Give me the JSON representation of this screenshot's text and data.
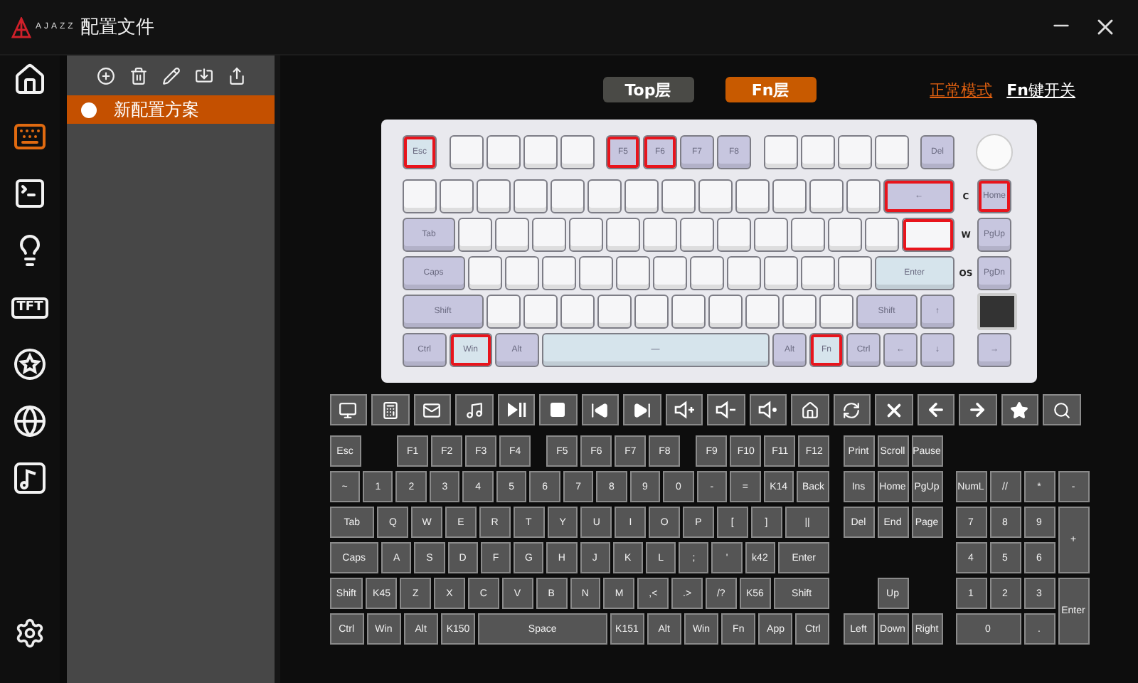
{
  "title_bar": {
    "brand": "AJAZZ",
    "title": "配置文件"
  },
  "nav": [
    {
      "selected": false
    },
    {
      "selected": true
    },
    {
      "selected": false
    },
    {
      "selected": false
    },
    {
      "label": "TFT",
      "selected": false
    },
    {
      "selected": false
    },
    {
      "selected": false
    },
    {
      "selected": false
    }
  ],
  "profiles": [
    {
      "name": "新配置方案",
      "selected": true
    }
  ],
  "layers": [
    {
      "label": "Top层",
      "selected": false
    },
    {
      "label": "Fn层",
      "selected": true
    }
  ],
  "modes": [
    {
      "label": "正常模式",
      "selected": true
    },
    {
      "label": "**Fn**键开关",
      "selected": false
    }
  ],
  "keyboard": {
    "indicators": [
      "C",
      "W",
      "OS"
    ],
    "function_row": [
      [
        {
          "kind": "blue",
          "label": "Esc",
          "selected": true
        }
      ],
      [
        {
          "kind": "white",
          "selected": false
        },
        {
          "kind": "white",
          "selected": false
        },
        {
          "kind": "white",
          "selected": false
        },
        {
          "kind": "white",
          "selected": false
        }
      ],
      [
        {
          "kind": "purple",
          "label": "F5",
          "selected": true
        },
        {
          "kind": "purple",
          "label": "F6",
          "selected": true
        },
        {
          "kind": "purple",
          "label": "F7",
          "selected": false
        },
        {
          "kind": "purple",
          "label": "F8",
          "selected": false
        }
      ],
      [
        {
          "kind": "white",
          "selected": false
        },
        {
          "kind": "white",
          "selected": false
        },
        {
          "kind": "white",
          "selected": false
        },
        {
          "kind": "white",
          "selected": false
        }
      ],
      [
        {
          "kind": "purple",
          "label": "Del",
          "selected": false
        }
      ]
    ],
    "rows": [
      {
        "keys": [
          {
            "kind": "white",
            "selected": false
          },
          {
            "kind": "white",
            "selected": false
          },
          {
            "kind": "white",
            "selected": false
          },
          {
            "kind": "white",
            "selected": false
          },
          {
            "kind": "white",
            "selected": false
          },
          {
            "kind": "white",
            "selected": false
          },
          {
            "kind": "white",
            "selected": false
          },
          {
            "kind": "white",
            "selected": false
          },
          {
            "kind": "white",
            "selected": false
          },
          {
            "kind": "white",
            "selected": false
          },
          {
            "kind": "white",
            "selected": false
          },
          {
            "kind": "white",
            "selected": false
          },
          {
            "kind": "white",
            "selected": false
          },
          {
            "kind": "purple",
            "label": "←",
            "selected": true
          },
          {
            "kind": "purple",
            "label": "Home",
            "selected": true
          }
        ]
      },
      {
        "keys": [
          {
            "kind": "purple",
            "label": "Tab",
            "selected": false
          },
          {
            "kind": "white",
            "selected": false
          },
          {
            "kind": "white",
            "selected": false
          },
          {
            "kind": "white",
            "selected": false
          },
          {
            "kind": "white",
            "selected": false
          },
          {
            "kind": "white",
            "selected": false
          },
          {
            "kind": "white",
            "selected": false
          },
          {
            "kind": "white",
            "selected": false
          },
          {
            "kind": "white",
            "selected": false
          },
          {
            "kind": "white",
            "selected": false
          },
          {
            "kind": "white",
            "selected": false
          },
          {
            "kind": "white",
            "selected": false
          },
          {
            "kind": "white",
            "selected": false
          },
          {
            "kind": "white",
            "selected": true
          },
          {
            "kind": "purple",
            "label": "PgUp",
            "selected": false
          }
        ]
      },
      {
        "keys": [
          {
            "kind": "purple",
            "label": "Caps",
            "selected": false
          },
          {
            "kind": "white",
            "selected": false
          },
          {
            "kind": "white",
            "selected": false
          },
          {
            "kind": "white",
            "selected": false
          },
          {
            "kind": "white",
            "selected": false
          },
          {
            "kind": "white",
            "selected": false
          },
          {
            "kind": "white",
            "selected": false
          },
          {
            "kind": "white",
            "selected": false
          },
          {
            "kind": "white",
            "selected": false
          },
          {
            "kind": "white",
            "selected": false
          },
          {
            "kind": "white",
            "selected": false
          },
          {
            "kind": "white",
            "selected": false
          },
          {
            "kind": "blue",
            "label": "Enter",
            "selected": false
          },
          {
            "kind": "purple",
            "label": "PgDn",
            "selected": false
          }
        ]
      },
      {
        "keys": [
          {
            "kind": "purple",
            "label": "Shift",
            "selected": false
          },
          {
            "kind": "white",
            "selected": false
          },
          {
            "kind": "white",
            "selected": false
          },
          {
            "kind": "white",
            "selected": false
          },
          {
            "kind": "white",
            "selected": false
          },
          {
            "kind": "white",
            "selected": false
          },
          {
            "kind": "white",
            "selected": false
          },
          {
            "kind": "white",
            "selected": false
          },
          {
            "kind": "white",
            "selected": false
          },
          {
            "kind": "white",
            "selected": false
          },
          {
            "kind": "white",
            "selected": false
          },
          {
            "kind": "purple",
            "label": "Shift",
            "selected": false
          },
          {
            "kind": "purple",
            "label": "↑",
            "selected": false
          }
        ]
      },
      {
        "keys": [
          {
            "kind": "purple",
            "label": "Ctrl",
            "selected": false
          },
          {
            "kind": "blue",
            "label": "Win",
            "selected": true
          },
          {
            "kind": "purple",
            "label": "Alt",
            "selected": false
          },
          {
            "kind": "blue",
            "label": "—",
            "selected": false
          },
          {
            "kind": "purple",
            "label": "Alt",
            "selected": false
          },
          {
            "kind": "blue",
            "label": "Fn",
            "selected": true
          },
          {
            "kind": "purple",
            "label": "Ctrl",
            "selected": false
          },
          {
            "kind": "purple",
            "label": "←",
            "selected": false
          },
          {
            "kind": "purple",
            "label": "↓",
            "selected": false
          },
          {
            "kind": "purple",
            "label": "→",
            "selected": false
          }
        ]
      }
    ]
  },
  "mapper": {
    "function_row": [
      [
        "Esc"
      ],
      [
        "F1",
        "F2",
        "F3",
        "F4"
      ],
      [
        "F5",
        "F6",
        "F7",
        "F8"
      ],
      [
        "F9",
        "F10",
        "F11",
        "F12"
      ]
    ],
    "main_rows": [
      [
        "~",
        "1",
        "2",
        "3",
        "4",
        "5",
        "6",
        "7",
        "8",
        "9",
        "0",
        "-",
        "=",
        "K14",
        "Back"
      ],
      [
        "Tab",
        "Q",
        "W",
        "E",
        "R",
        "T",
        "Y",
        "U",
        "I",
        "O",
        "P",
        "[",
        "]",
        "||"
      ],
      [
        "Caps",
        "A",
        "S",
        "D",
        "F",
        "G",
        "H",
        "J",
        "K",
        "L",
        ";",
        "'",
        "k42",
        "Enter"
      ],
      [
        "Shift",
        "K45",
        "Z",
        "X",
        "C",
        "V",
        "B",
        "N",
        "M",
        ",<",
        ".>",
        "/?",
        "K56",
        "Shift"
      ],
      [
        "Ctrl",
        "Win",
        "Alt",
        "K150",
        "Space",
        "K151",
        "Alt",
        "Win",
        "Fn",
        "App",
        "Ctrl"
      ]
    ],
    "nav_keys": [
      "Print",
      "Scroll",
      "Pause",
      "Ins",
      "Home",
      "PgUp",
      "Del",
      "End",
      "Page",
      "Up",
      "Left",
      "Down",
      "Right"
    ],
    "numpad": [
      "NumL",
      "//",
      "*",
      "-",
      "7",
      "8",
      "9",
      "+",
      "4",
      "5",
      "6",
      "1",
      "2",
      "3",
      "Enter",
      "0",
      "."
    ]
  }
}
